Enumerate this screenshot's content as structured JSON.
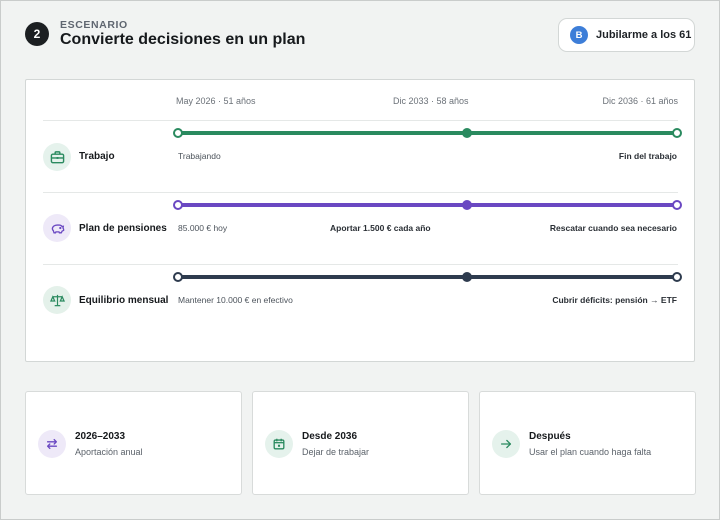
{
  "header": {
    "step_number": "2",
    "eyebrow": "ESCENARIO",
    "title": "Convierte decisiones en un plan"
  },
  "scenario": {
    "avatar_letter": "B",
    "label": "Jubilarme a los 61"
  },
  "timeline": {
    "dates": [
      "May 2026 · 51 años",
      "Dic 2033 · 58 años",
      "Dic 2036 · 61 años"
    ],
    "rows": [
      {
        "label": "Trabajo",
        "icon": "briefcase-icon",
        "color": "#2a8a5f",
        "tint": "#e5f2ec",
        "start_caption": "Trabajando",
        "mid_caption": "",
        "end_caption": "Fin del trabajo"
      },
      {
        "label": "Plan de pensiones",
        "icon": "piggy-bank-icon",
        "color": "#6a48c2",
        "tint": "#eee9f8",
        "start_caption": "85.000 € hoy",
        "mid_caption": "Aportar 1.500 € cada año",
        "end_caption": "Rescatar cuando sea necesario"
      },
      {
        "label": "Equilibrio mensual",
        "icon": "scale-icon",
        "color": "#2e3b4e",
        "tint": "#e4f1ea",
        "start_caption": "Mantener 10.000 € en efectivo",
        "mid_caption": "",
        "end_caption": "Cubrir déficits: pensión → ETF"
      }
    ]
  },
  "summary": [
    {
      "title": "2026–2033",
      "subtitle": "Aportación anual",
      "icon": "repeat-arrows-icon",
      "color": "#6a48c2",
      "tint": "#eee9f8"
    },
    {
      "title": "Desde 2036",
      "subtitle": "Dejar de trabajar",
      "icon": "calendar-icon",
      "color": "#2a8a5f",
      "tint": "#e5f2ec"
    },
    {
      "title": "Después",
      "subtitle": "Usar el plan cuando haga falta",
      "icon": "arrow-right-icon",
      "color": "#2a8a5f",
      "tint": "#e5f2ec"
    }
  ]
}
